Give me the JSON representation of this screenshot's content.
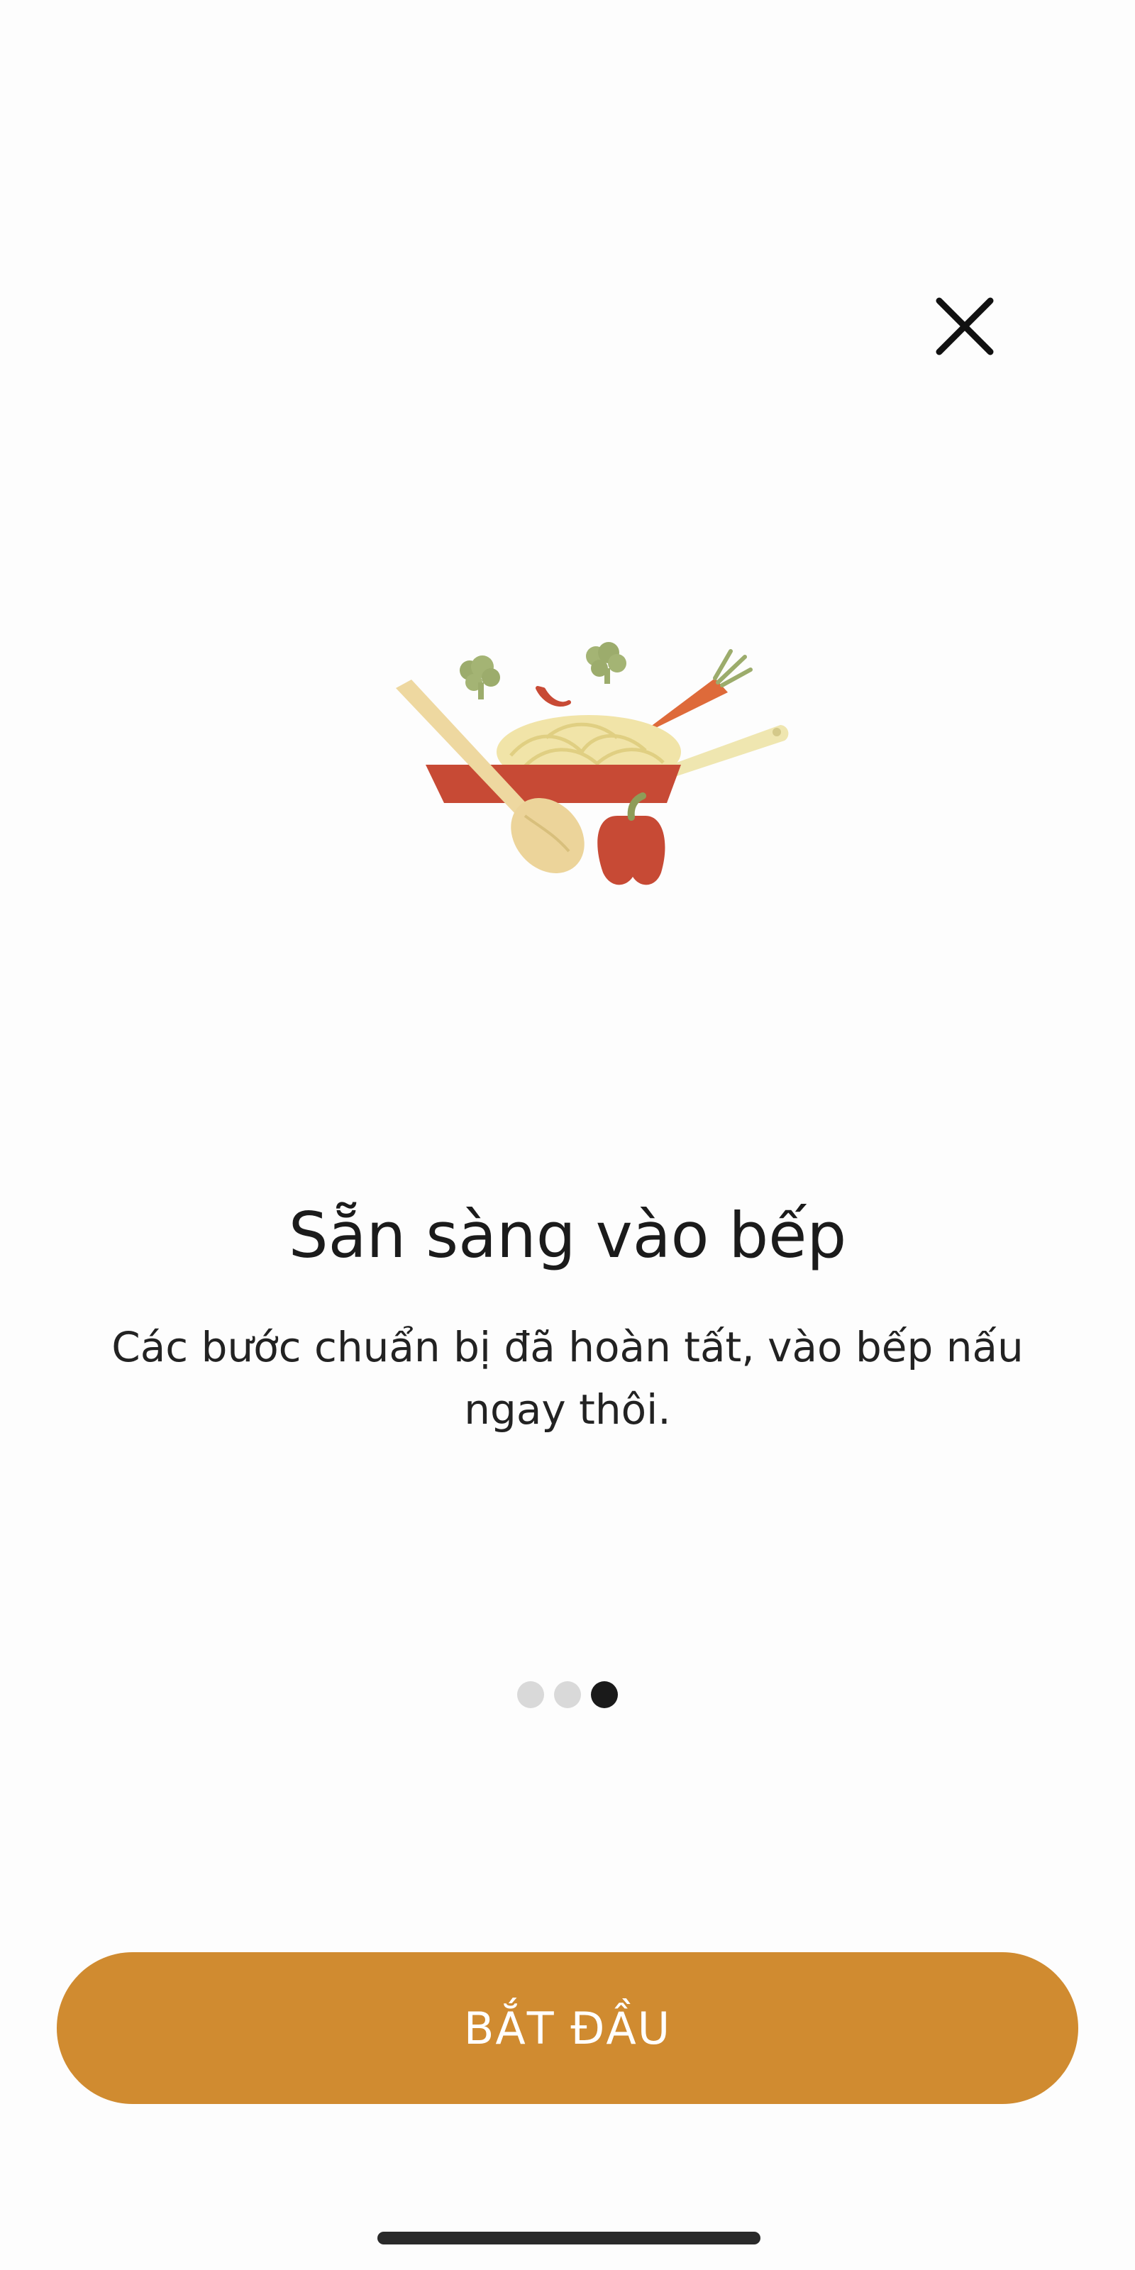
{
  "onboarding": {
    "title": "Sẵn sàng vào bếp",
    "description": "Các bước chuẩn bị đã hoàn tất, vào bếp nấu ngay thôi.",
    "start_label": "BẮT ĐẦU",
    "page_indicator": {
      "total": 3,
      "current": 3
    },
    "close_icon": "close-icon",
    "illustration_icon": "cooking-pan-illustration"
  },
  "colors": {
    "accent": "#d08b30",
    "text": "#1b1b1b",
    "dot_inactive": "#d9d9d9",
    "dot_active": "#1a1a1a"
  }
}
